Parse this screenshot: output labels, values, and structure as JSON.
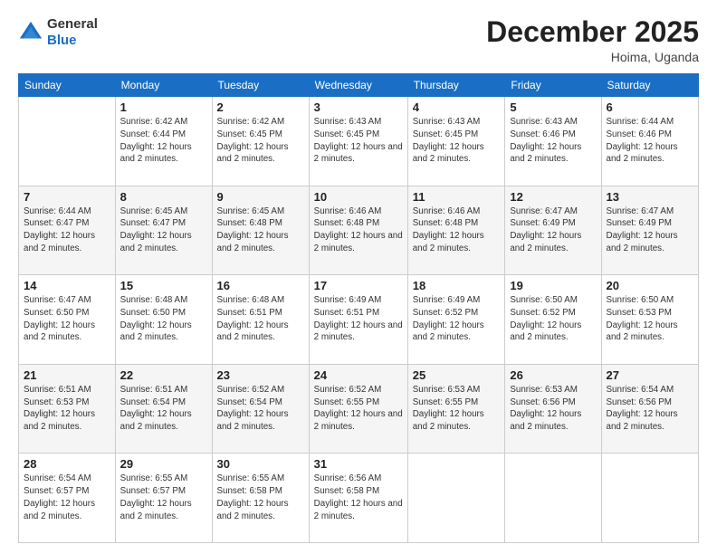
{
  "header": {
    "logo": {
      "general": "General",
      "blue": "Blue"
    },
    "title": "December 2025",
    "location": "Hoima, Uganda"
  },
  "days_of_week": [
    "Sunday",
    "Monday",
    "Tuesday",
    "Wednesday",
    "Thursday",
    "Friday",
    "Saturday"
  ],
  "weeks": [
    [
      {
        "day": "",
        "sunrise": "",
        "sunset": "",
        "daylight": ""
      },
      {
        "day": "1",
        "sunrise": "Sunrise: 6:42 AM",
        "sunset": "Sunset: 6:44 PM",
        "daylight": "Daylight: 12 hours and 2 minutes."
      },
      {
        "day": "2",
        "sunrise": "Sunrise: 6:42 AM",
        "sunset": "Sunset: 6:45 PM",
        "daylight": "Daylight: 12 hours and 2 minutes."
      },
      {
        "day": "3",
        "sunrise": "Sunrise: 6:43 AM",
        "sunset": "Sunset: 6:45 PM",
        "daylight": "Daylight: 12 hours and 2 minutes."
      },
      {
        "day": "4",
        "sunrise": "Sunrise: 6:43 AM",
        "sunset": "Sunset: 6:45 PM",
        "daylight": "Daylight: 12 hours and 2 minutes."
      },
      {
        "day": "5",
        "sunrise": "Sunrise: 6:43 AM",
        "sunset": "Sunset: 6:46 PM",
        "daylight": "Daylight: 12 hours and 2 minutes."
      },
      {
        "day": "6",
        "sunrise": "Sunrise: 6:44 AM",
        "sunset": "Sunset: 6:46 PM",
        "daylight": "Daylight: 12 hours and 2 minutes."
      }
    ],
    [
      {
        "day": "7",
        "sunrise": "Sunrise: 6:44 AM",
        "sunset": "Sunset: 6:47 PM",
        "daylight": "Daylight: 12 hours and 2 minutes."
      },
      {
        "day": "8",
        "sunrise": "Sunrise: 6:45 AM",
        "sunset": "Sunset: 6:47 PM",
        "daylight": "Daylight: 12 hours and 2 minutes."
      },
      {
        "day": "9",
        "sunrise": "Sunrise: 6:45 AM",
        "sunset": "Sunset: 6:48 PM",
        "daylight": "Daylight: 12 hours and 2 minutes."
      },
      {
        "day": "10",
        "sunrise": "Sunrise: 6:46 AM",
        "sunset": "Sunset: 6:48 PM",
        "daylight": "Daylight: 12 hours and 2 minutes."
      },
      {
        "day": "11",
        "sunrise": "Sunrise: 6:46 AM",
        "sunset": "Sunset: 6:48 PM",
        "daylight": "Daylight: 12 hours and 2 minutes."
      },
      {
        "day": "12",
        "sunrise": "Sunrise: 6:47 AM",
        "sunset": "Sunset: 6:49 PM",
        "daylight": "Daylight: 12 hours and 2 minutes."
      },
      {
        "day": "13",
        "sunrise": "Sunrise: 6:47 AM",
        "sunset": "Sunset: 6:49 PM",
        "daylight": "Daylight: 12 hours and 2 minutes."
      }
    ],
    [
      {
        "day": "14",
        "sunrise": "Sunrise: 6:47 AM",
        "sunset": "Sunset: 6:50 PM",
        "daylight": "Daylight: 12 hours and 2 minutes."
      },
      {
        "day": "15",
        "sunrise": "Sunrise: 6:48 AM",
        "sunset": "Sunset: 6:50 PM",
        "daylight": "Daylight: 12 hours and 2 minutes."
      },
      {
        "day": "16",
        "sunrise": "Sunrise: 6:48 AM",
        "sunset": "Sunset: 6:51 PM",
        "daylight": "Daylight: 12 hours and 2 minutes."
      },
      {
        "day": "17",
        "sunrise": "Sunrise: 6:49 AM",
        "sunset": "Sunset: 6:51 PM",
        "daylight": "Daylight: 12 hours and 2 minutes."
      },
      {
        "day": "18",
        "sunrise": "Sunrise: 6:49 AM",
        "sunset": "Sunset: 6:52 PM",
        "daylight": "Daylight: 12 hours and 2 minutes."
      },
      {
        "day": "19",
        "sunrise": "Sunrise: 6:50 AM",
        "sunset": "Sunset: 6:52 PM",
        "daylight": "Daylight: 12 hours and 2 minutes."
      },
      {
        "day": "20",
        "sunrise": "Sunrise: 6:50 AM",
        "sunset": "Sunset: 6:53 PM",
        "daylight": "Daylight: 12 hours and 2 minutes."
      }
    ],
    [
      {
        "day": "21",
        "sunrise": "Sunrise: 6:51 AM",
        "sunset": "Sunset: 6:53 PM",
        "daylight": "Daylight: 12 hours and 2 minutes."
      },
      {
        "day": "22",
        "sunrise": "Sunrise: 6:51 AM",
        "sunset": "Sunset: 6:54 PM",
        "daylight": "Daylight: 12 hours and 2 minutes."
      },
      {
        "day": "23",
        "sunrise": "Sunrise: 6:52 AM",
        "sunset": "Sunset: 6:54 PM",
        "daylight": "Daylight: 12 hours and 2 minutes."
      },
      {
        "day": "24",
        "sunrise": "Sunrise: 6:52 AM",
        "sunset": "Sunset: 6:55 PM",
        "daylight": "Daylight: 12 hours and 2 minutes."
      },
      {
        "day": "25",
        "sunrise": "Sunrise: 6:53 AM",
        "sunset": "Sunset: 6:55 PM",
        "daylight": "Daylight: 12 hours and 2 minutes."
      },
      {
        "day": "26",
        "sunrise": "Sunrise: 6:53 AM",
        "sunset": "Sunset: 6:56 PM",
        "daylight": "Daylight: 12 hours and 2 minutes."
      },
      {
        "day": "27",
        "sunrise": "Sunrise: 6:54 AM",
        "sunset": "Sunset: 6:56 PM",
        "daylight": "Daylight: 12 hours and 2 minutes."
      }
    ],
    [
      {
        "day": "28",
        "sunrise": "Sunrise: 6:54 AM",
        "sunset": "Sunset: 6:57 PM",
        "daylight": "Daylight: 12 hours and 2 minutes."
      },
      {
        "day": "29",
        "sunrise": "Sunrise: 6:55 AM",
        "sunset": "Sunset: 6:57 PM",
        "daylight": "Daylight: 12 hours and 2 minutes."
      },
      {
        "day": "30",
        "sunrise": "Sunrise: 6:55 AM",
        "sunset": "Sunset: 6:58 PM",
        "daylight": "Daylight: 12 hours and 2 minutes."
      },
      {
        "day": "31",
        "sunrise": "Sunrise: 6:56 AM",
        "sunset": "Sunset: 6:58 PM",
        "daylight": "Daylight: 12 hours and 2 minutes."
      },
      {
        "day": "",
        "sunrise": "",
        "sunset": "",
        "daylight": ""
      },
      {
        "day": "",
        "sunrise": "",
        "sunset": "",
        "daylight": ""
      },
      {
        "day": "",
        "sunrise": "",
        "sunset": "",
        "daylight": ""
      }
    ]
  ]
}
